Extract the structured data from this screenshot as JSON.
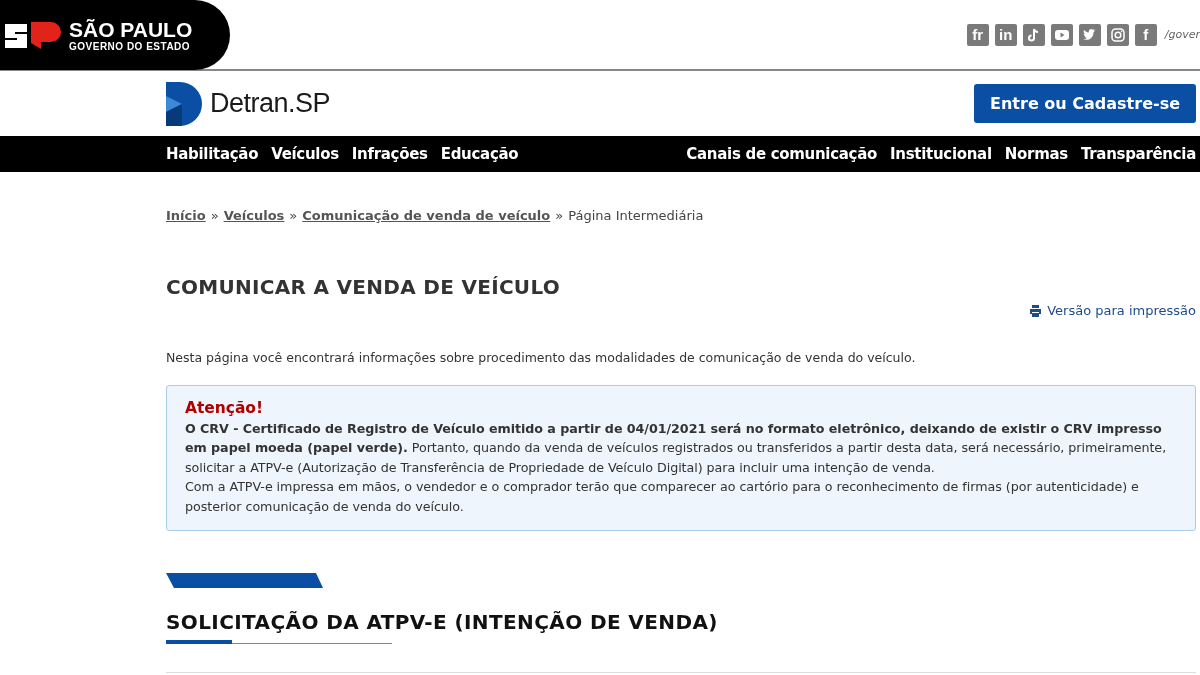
{
  "gov_bar": {
    "title": "SÃO PAULO",
    "subtitle": "GOVERNO DO ESTADO",
    "social": [
      {
        "kind": "text",
        "label": "fr"
      },
      {
        "kind": "text",
        "label": "in"
      },
      {
        "kind": "tiktok"
      },
      {
        "kind": "youtube"
      },
      {
        "kind": "twitter"
      },
      {
        "kind": "instagram"
      },
      {
        "kind": "text",
        "label": "f"
      }
    ],
    "handle": "/gover"
  },
  "header": {
    "logo": "Detran.SP",
    "login_button": "Entre ou Cadastre-se"
  },
  "nav": {
    "left": [
      "Habilitação",
      "Veículos",
      "Infrações",
      "Educação"
    ],
    "right": [
      "Canais de comunicação",
      "Institucional",
      "Normas",
      "Transparência"
    ]
  },
  "breadcrumb": {
    "links": [
      "Início",
      "Veículos",
      "Comunicação de venda de veículo"
    ],
    "separator": "»",
    "current": "Página Intermediária"
  },
  "page_title": "COMUNICAR A VENDA DE VEÍCULO",
  "print_link": "Versão para impressão",
  "intro": "Nesta página você encontrará informações sobre procedimento das modalidades de comunicação de venda do veículo.",
  "alert": {
    "title": "Atenção!",
    "paragraphs": [
      "**O CRV - Certificado de Registro de Veículo emitido a partir de 04/01/2021 será no formato eletrônico, deixando de existir o CRV impresso em papel moeda (papel verde).** Portanto, quando da venda de veículos registrados ou transferidos a partir desta data, será necessário, primeiramente, solicitar a ATPV-e (Autorização de Transferência de Propriedade de Veículo Digital) para incluir uma intenção de venda.",
      "Com a ATPV-e impressa em mãos, o vendedor e o comprador terão que comparecer ao cartório para o reconhecimento de firmas (por autenticidade) e posterior comunicação de venda do veículo."
    ]
  },
  "section_heading": "SOLICITAÇÃO DA ATPV-E (INTENÇÃO DE VENDA)"
}
